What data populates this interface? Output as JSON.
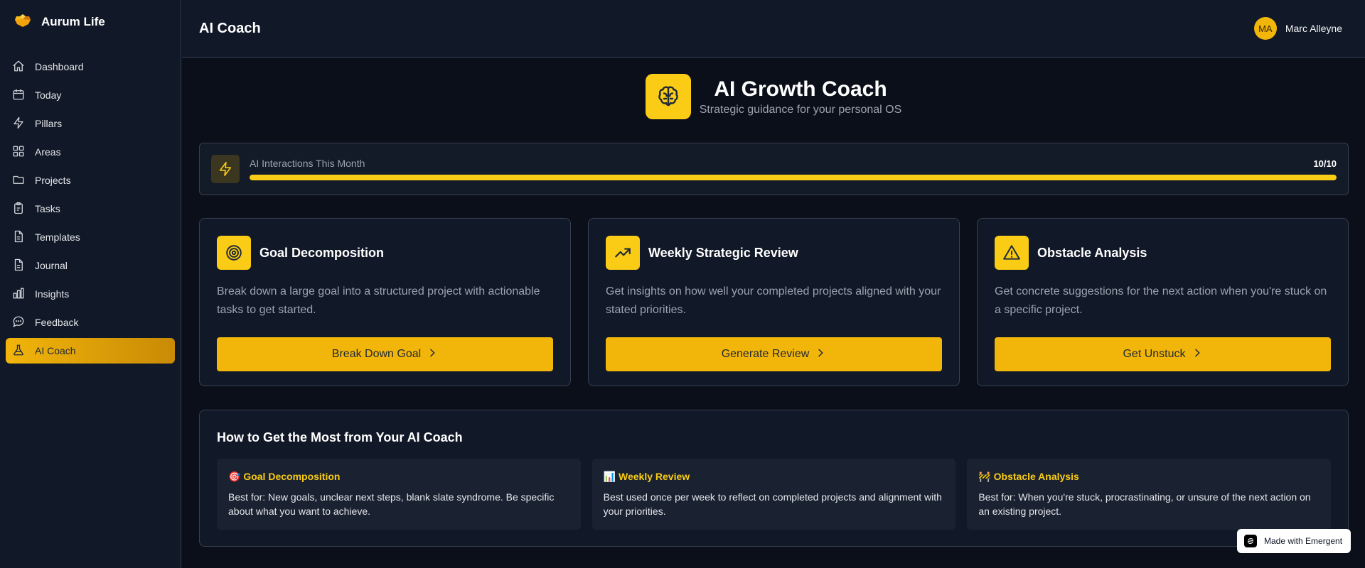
{
  "brand": {
    "name": "Aurum Life",
    "icon": "aurum-logo-icon",
    "accent": "#facc15"
  },
  "sidebar": {
    "items": [
      {
        "label": "Dashboard",
        "icon": "home-icon"
      },
      {
        "label": "Today",
        "icon": "calendar-icon"
      },
      {
        "label": "Pillars",
        "icon": "lightning-icon"
      },
      {
        "label": "Areas",
        "icon": "grid-icon"
      },
      {
        "label": "Projects",
        "icon": "folder-icon"
      },
      {
        "label": "Tasks",
        "icon": "clipboard-icon"
      },
      {
        "label": "Templates",
        "icon": "document-icon"
      },
      {
        "label": "Journal",
        "icon": "document-icon"
      },
      {
        "label": "Insights",
        "icon": "bar-chart-icon"
      },
      {
        "label": "Feedback",
        "icon": "chat-icon"
      },
      {
        "label": "AI Coach",
        "icon": "flask-icon",
        "active": true
      }
    ]
  },
  "header": {
    "title": "AI Coach",
    "user": {
      "initials": "MA",
      "name": "Marc Alleyne"
    }
  },
  "hero": {
    "title": "AI Growth Coach",
    "subtitle": "Strategic guidance for your personal OS",
    "icon": "brain-icon"
  },
  "usage": {
    "label": "AI Interactions This Month",
    "count_text": "10/10",
    "used": 10,
    "limit": 10,
    "fill_fraction": 1.0
  },
  "cards": [
    {
      "title": "Goal Decomposition",
      "icon": "target-icon",
      "description": "Break down a large goal into a structured project with actionable tasks to get started.",
      "button": "Break Down Goal"
    },
    {
      "title": "Weekly Strategic Review",
      "icon": "trending-up-icon",
      "description": "Get insights on how well your completed projects aligned with your stated priorities.",
      "button": "Generate Review"
    },
    {
      "title": "Obstacle Analysis",
      "icon": "warning-icon",
      "description": "Get concrete suggestions for the next action when you're stuck on a specific project.",
      "button": "Get Unstuck"
    }
  ],
  "tips": {
    "title": "How to Get the Most from Your AI Coach",
    "items": [
      {
        "emoji": "🎯",
        "title": "Goal Decomposition",
        "description": "Best for: New goals, unclear next steps, blank slate syndrome. Be specific about what you want to achieve."
      },
      {
        "emoji": "📊",
        "title": "Weekly Review",
        "description": "Best used once per week to reflect on completed projects and alignment with your priorities."
      },
      {
        "emoji": "🚧",
        "title": "Obstacle Analysis",
        "description": "Best for: When you're stuck, procrastinating, or unsure of the next action on an existing project."
      }
    ]
  },
  "badge": {
    "label": "Made with Emergent",
    "icon": "emergent-logo-icon"
  }
}
